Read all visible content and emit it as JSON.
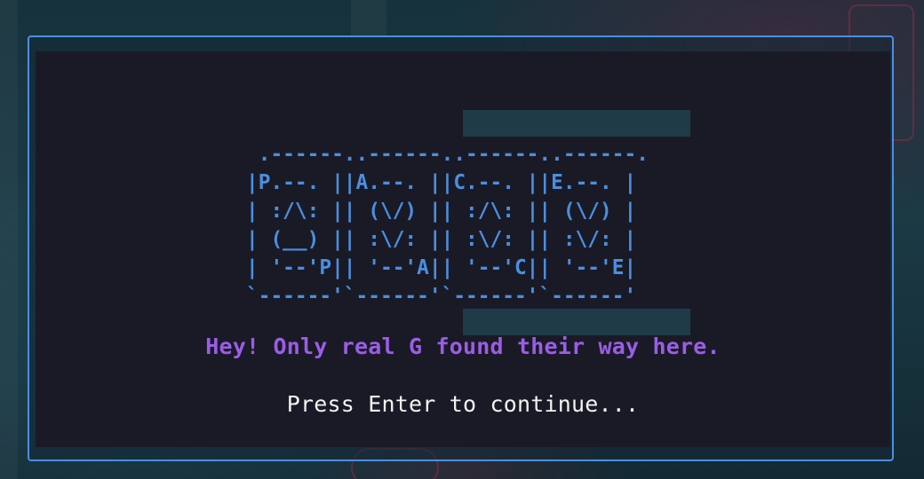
{
  "ascii_art": {
    "lines": [
      " .------..------..------..------.",
      "|P.--. ||A.--. ||C.--. ||E.--. |",
      "| :/\\: || (\\/) || :/\\: || (\\/) |",
      "| (__) || :\\/: || :\\/: || :\\/: |",
      "| '--'P|| '--'A|| '--'C|| '--'E|",
      "`------'`------'`------'`------'"
    ]
  },
  "message": "Hey! Only real G found their way here.",
  "prompt": "Press Enter to continue...",
  "colors": {
    "border": "#4a8fe0",
    "ascii": "#4a8fe0",
    "message": "#9b5de5",
    "prompt": "#f2f2f2",
    "terminal_bg": "#1a1a26"
  }
}
